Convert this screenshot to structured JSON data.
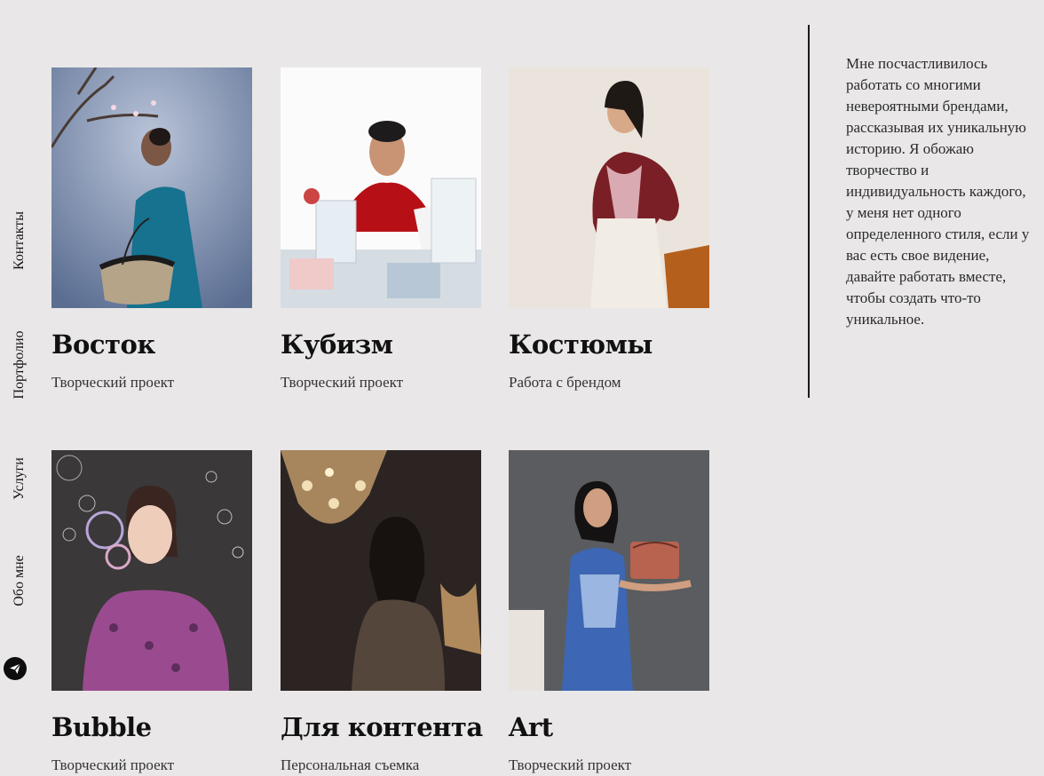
{
  "nav": {
    "items": [
      {
        "label": "Контакты"
      },
      {
        "label": "Портфолио"
      },
      {
        "label": "Услуги"
      },
      {
        "label": "Обо мне"
      }
    ],
    "telegram_icon": "telegram-icon"
  },
  "gallery": {
    "cards": [
      {
        "title": "Восток",
        "subtitle": "Творческий проект",
        "photo": "woman-blue-dress-cherry-branch"
      },
      {
        "title": "Кубизм",
        "subtitle": "Творческий проект",
        "photo": "woman-red-scarf-glassware"
      },
      {
        "title": "Костюмы",
        "subtitle": "Работа с брендом",
        "photo": "woman-burgundy-hoodie-pink-sweater"
      },
      {
        "title": "Bubble",
        "subtitle": "Творческий проект",
        "photo": "woman-purple-dress-soap-bubbles"
      },
      {
        "title": "Для контента",
        "subtitle": "Персональная съемка",
        "photo": "woman-crystal-chandelier"
      },
      {
        "title": "Art",
        "subtitle": "Творческий проект",
        "photo": "woman-blue-dress-leather-bag"
      }
    ]
  },
  "about": {
    "text": "Мне посчастливилось работать со многими невероятными брендами, рассказывая их уникальную историю. Я обожаю творчество и индивидуальность каждого, у меня нет одного определенного стиля, если у вас есть свое видение, давайте работать вместе, чтобы создать что-то уникальное."
  }
}
